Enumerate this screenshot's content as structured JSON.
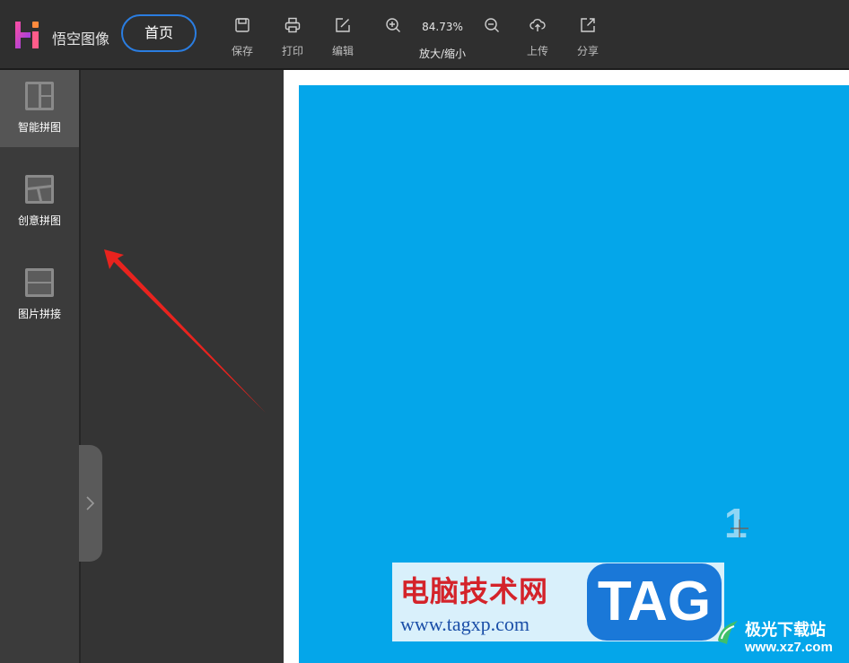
{
  "app": {
    "name": "悟空图像"
  },
  "nav": {
    "home_label": "首页"
  },
  "toolbar": {
    "save_label": "保存",
    "print_label": "打印",
    "edit_label": "编辑",
    "zoom_value": "84.73%",
    "zoom_label": "放大/缩小",
    "upload_label": "上传",
    "share_label": "分享"
  },
  "sidebar": {
    "items": [
      {
        "label": "智能拼图",
        "icon": "smart-collage-icon",
        "active": true
      },
      {
        "label": "创意拼图",
        "icon": "creative-collage-icon",
        "active": false
      },
      {
        "label": "图片拼接",
        "icon": "image-stitch-icon",
        "active": false
      }
    ]
  },
  "canvas": {
    "background_color": "#04a6ea",
    "cell_number": "1"
  },
  "watermarks": {
    "primary_title": "电脑技术网",
    "primary_url": "www.tagxp.com",
    "tag": "TAG",
    "secondary_title": "极光下载站",
    "secondary_url": "www.xz7.com"
  },
  "colors": {
    "accent": "#2a7de1",
    "annotation_arrow": "#e8231e"
  }
}
